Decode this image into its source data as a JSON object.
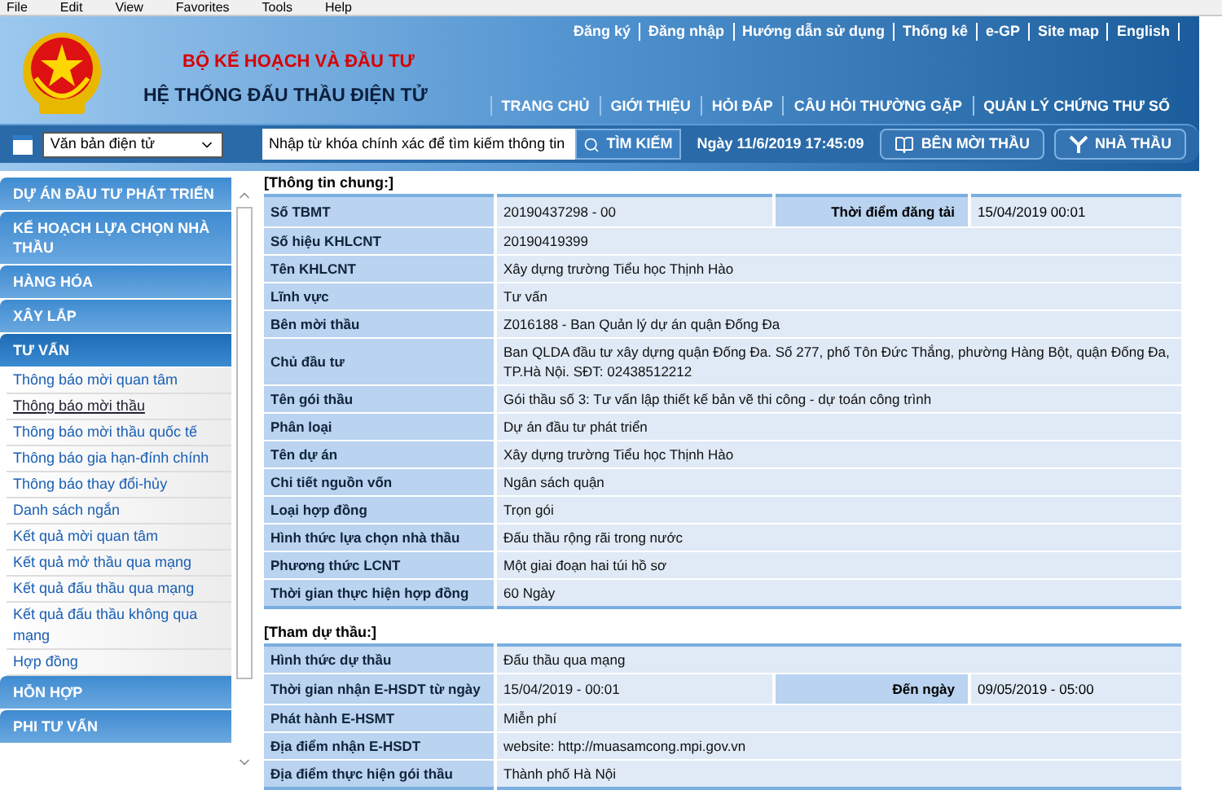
{
  "menu_bar": [
    "File",
    "Edit",
    "View",
    "Favorites",
    "Tools",
    "Help"
  ],
  "header": {
    "ministry": "BỘ KẾ HOẠCH VÀ ĐẦU TƯ",
    "system_title": "HỆ THỐNG ĐẤU THẦU ĐIỆN TỬ",
    "top_links": [
      "Đăng ký",
      "Đăng nhập",
      "Hướng dẫn sử dụng",
      "Thống kê",
      "e-GP",
      "Site map",
      "English"
    ],
    "nav": [
      "TRANG CHỦ",
      "GIỚI THIỆU",
      "HỎI ĐÁP",
      "CÂU HỎI THƯỜNG GẶP",
      "QUẢN LÝ CHỨNG THƯ SỐ"
    ]
  },
  "toolbar": {
    "doc_select": "Văn bản điện tử",
    "search": {
      "value": "Nhập từ khóa chính xác để tìm kiếm thông tin"
    },
    "search_button": "TÌM KIẾM",
    "date": "Ngày 11/6/2019 17:45:09",
    "buttons": [
      {
        "kind": "book",
        "label": "BÊN MỜI THẦU"
      },
      {
        "kind": "antenna",
        "label": "NHÀ THẦU"
      }
    ]
  },
  "sidebar": [
    {
      "label": "DỰ ÁN ĐẦU TƯ PHÁT TRIỂN",
      "expanded": false
    },
    {
      "label": "KẾ HOẠCH LỰA CHỌN NHÀ THẦU",
      "expanded": false
    },
    {
      "label": "HÀNG HÓA",
      "expanded": false
    },
    {
      "label": "XÂY LẮP",
      "expanded": false
    },
    {
      "label": "TƯ VẤN",
      "expanded": true,
      "children": [
        {
          "label": "Thông báo mời quan tâm",
          "selected": false
        },
        {
          "label": "Thông báo mời thầu",
          "selected": true
        },
        {
          "label": "Thông báo mời thầu quốc tế",
          "selected": false
        },
        {
          "label": "Thông báo gia hạn-đính chính",
          "selected": false
        },
        {
          "label": "Thông báo thay đổi-hủy",
          "selected": false
        },
        {
          "label": "Danh sách ngắn",
          "selected": false
        },
        {
          "label": "Kết quả mời quan tâm",
          "selected": false
        },
        {
          "label": "Kết quả mở thầu qua mạng",
          "selected": false
        },
        {
          "label": "Kết quả đấu thầu qua mạng",
          "selected": false
        },
        {
          "label": "Kết quả đấu thầu không qua mạng",
          "selected": false
        },
        {
          "label": "Hợp đồng",
          "selected": false
        }
      ]
    },
    {
      "label": "HỖN HỢP",
      "expanded": false
    },
    {
      "label": "PHI TƯ VẤN",
      "expanded": false
    }
  ],
  "sections": [
    {
      "title": "[Thông tin chung:]",
      "rows": [
        {
          "label": "Số TBMT",
          "value": "20190437298   -   00",
          "extra_label": "Thời điểm đăng tải",
          "extra_value": "15/04/2019 00:01"
        },
        {
          "label": "Số hiệu KHLCNT",
          "value": "20190419399"
        },
        {
          "label": "Tên KHLCNT",
          "value": "Xây dựng trường Tiểu học Thịnh Hào"
        },
        {
          "label": "Lĩnh vực",
          "value": "Tư vấn"
        },
        {
          "label": "Bên mời thầu",
          "value": "Z016188 - Ban Quản lý dự án quận Đống Đa"
        },
        {
          "label": "Chủ đầu tư",
          "value": "Ban QLDA đầu tư xây dựng quận Đống Đa. Số 277, phố Tôn Đức Thắng, phường Hàng Bột, quận Đống Đa, TP.Hà Nội. SĐT: 02438512212"
        },
        {
          "label": "Tên gói thầu",
          "value": "Gói thầu số 3: Tư vấn lập thiết kế bản vẽ thi công - dự toán công trình"
        },
        {
          "label": "Phân loại",
          "value": "Dự án đầu tư phát triển"
        },
        {
          "label": "Tên dự án",
          "value": "Xây dựng trường Tiểu học Thịnh Hào"
        },
        {
          "label": "Chi tiết nguồn vốn",
          "value": "Ngân sách quận"
        },
        {
          "label": "Loại hợp đồng",
          "value": "Trọn gói"
        },
        {
          "label": "Hình thức lựa chọn nhà thầu",
          "value": "Đấu thầu rộng rãi trong nước"
        },
        {
          "label": "Phương thức LCNT",
          "value": "Một giai đoạn hai túi hồ sơ"
        },
        {
          "label": "Thời gian thực hiện hợp đồng",
          "value": "60 Ngày"
        }
      ]
    },
    {
      "title": "[Tham dự thầu:]",
      "rows": [
        {
          "label": "Hình thức dự thầu",
          "value": "Đấu thầu qua mạng"
        },
        {
          "label": "Thời gian nhận E-HSDT từ ngày",
          "value": "15/04/2019 - 00:01",
          "extra_label": "Đến ngày",
          "extra_value": "09/05/2019 - 05:00"
        },
        {
          "label": "Phát hành E-HSMT",
          "value": "Miễn phí"
        },
        {
          "label": "Địa điểm nhận E-HSDT",
          "value": "website: http://muasamcong.mpi.gov.vn"
        },
        {
          "label": "Địa điểm thực hiện gói thầu",
          "value": "Thành phố Hà Nội"
        }
      ]
    }
  ]
}
